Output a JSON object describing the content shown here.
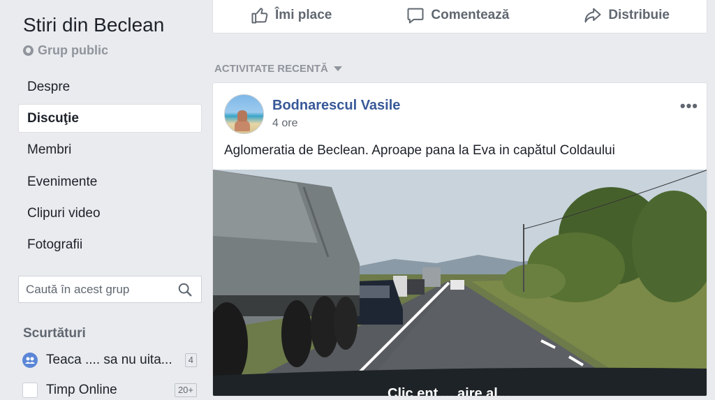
{
  "group": {
    "name": "Stiri din Beclean",
    "privacy": "Grup public"
  },
  "nav": {
    "items": [
      {
        "label": "Despre",
        "active": false
      },
      {
        "label": "Discuţie",
        "active": true
      },
      {
        "label": "Membri",
        "active": false
      },
      {
        "label": "Evenimente",
        "active": false
      },
      {
        "label": "Clipuri video",
        "active": false
      },
      {
        "label": "Fotografii",
        "active": false
      }
    ]
  },
  "search": {
    "placeholder": "Caută în acest grup",
    "icon": "search-icon"
  },
  "shortcuts": {
    "title": "Scurtături",
    "items": [
      {
        "label": "Teaca .... sa nu uita...",
        "count": "4",
        "icon": "group-icon"
      },
      {
        "label": "Timp Online",
        "count": "20+",
        "icon": "page-icon"
      }
    ]
  },
  "post_actions": {
    "like": "Îmi place",
    "comment": "Comentează",
    "share": "Distribuie"
  },
  "feed": {
    "section_label": "ACTIVITATE RECENTĂ"
  },
  "post": {
    "author": "Bodnarescul Vasile",
    "time": "4 ore",
    "text": "Aglomeratia de Beclean. Aproape pana la Eva in capătul Coldaului",
    "more": "•••",
    "media_caption": "Clic ent ... aire al..."
  },
  "colors": {
    "background": "#e9ebee",
    "link": "#385898",
    "muted": "#606770"
  }
}
